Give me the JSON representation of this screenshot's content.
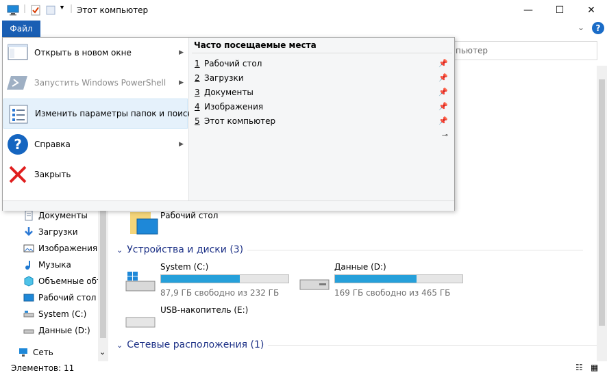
{
  "window": {
    "title": "Этот компьютер",
    "minimize_glyph": "—",
    "maximize_glyph": "☐",
    "close_glyph": "✕"
  },
  "ribbon": {
    "file_tab": "Файл",
    "collapse_glyph": "⌄",
    "help_glyph": "?"
  },
  "address": {
    "text": "пьютер"
  },
  "file_menu": {
    "items": [
      {
        "label": "Открыть в новом окне",
        "has_submenu": true,
        "enabled": true,
        "icon": "new-window-icon"
      },
      {
        "label": "Запустить Windows PowerShell",
        "has_submenu": true,
        "enabled": false,
        "icon": "powershell-icon"
      },
      {
        "label": "Изменить параметры папок и поиска",
        "has_submenu": false,
        "enabled": true,
        "selected": true,
        "icon": "folder-options-icon"
      },
      {
        "label": "Справка",
        "has_submenu": true,
        "enabled": true,
        "icon": "help-icon"
      },
      {
        "label": "Закрыть",
        "has_submenu": false,
        "enabled": true,
        "icon": "close-icon"
      }
    ],
    "recent_header": "Часто посещаемые места",
    "recent": [
      {
        "num": "1",
        "label": "Рабочий стол"
      },
      {
        "num": "2",
        "label": "Загрузки"
      },
      {
        "num": "3",
        "label": "Документы"
      },
      {
        "num": "4",
        "label": "Изображения"
      },
      {
        "num": "5",
        "label": "Этот компьютер"
      }
    ],
    "arrow_glyph": "▶",
    "pin_glyph": "📌",
    "unpinned_glyph": "⊸"
  },
  "nav_pane": {
    "items": [
      {
        "label": "Документы",
        "icon": "documents-icon"
      },
      {
        "label": "Загрузки",
        "icon": "downloads-icon"
      },
      {
        "label": "Изображения",
        "icon": "pictures-icon"
      },
      {
        "label": "Музыка",
        "icon": "music-icon"
      },
      {
        "label": "Объемные объ",
        "icon": "3d-objects-icon"
      },
      {
        "label": "Рабочий стол",
        "icon": "desktop-icon"
      },
      {
        "label": "System (C:)",
        "icon": "drive-icon"
      },
      {
        "label": "Данные (D:)",
        "icon": "drive-icon"
      },
      {
        "label": "Сеть",
        "icon": "network-icon"
      }
    ],
    "scroll_down_glyph": "⌄"
  },
  "content": {
    "folder_desktop": "Рабочий стол",
    "devices_header": "Устройства и диски (3)",
    "network_header": "Сетевые расположения (1)",
    "section_chevron": "⌄",
    "drives": [
      {
        "name": "System (C:)",
        "free_text": "87,9 ГБ свободно из 232 ГБ",
        "used_fraction": 0.62
      },
      {
        "name": "Данные (D:)",
        "free_text": "169 ГБ свободно из 465 ГБ",
        "used_fraction": 0.64
      },
      {
        "name": "USB-накопитель (E:)"
      }
    ]
  },
  "status": {
    "items_text": "Элементов: 11"
  },
  "colors": {
    "accent": "#1a5fb4",
    "drive_fill": "#26a0da",
    "section": "#1e3287"
  }
}
